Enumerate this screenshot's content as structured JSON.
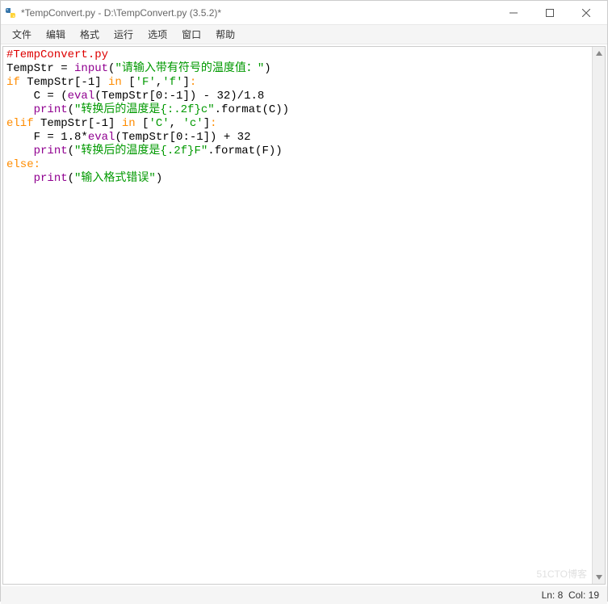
{
  "window": {
    "title": "*TempConvert.py - D:\\TempConvert.py (3.5.2)*"
  },
  "menu": {
    "items": [
      "文件",
      "编辑",
      "格式",
      "运行",
      "选项",
      "窗口",
      "帮助"
    ]
  },
  "code": {
    "lines": [
      {
        "tokens": [
          {
            "t": "#TempConvert.py",
            "c": "c-comment"
          }
        ]
      },
      {
        "tokens": [
          {
            "t": "TempStr = ",
            "c": ""
          },
          {
            "t": "input",
            "c": "c-builtin"
          },
          {
            "t": "(",
            "c": ""
          },
          {
            "t": "\"请输入带有符号的温度值：\"",
            "c": "c-str"
          },
          {
            "t": ")",
            "c": ""
          }
        ]
      },
      {
        "tokens": [
          {
            "t": "if",
            "c": "c-kw"
          },
          {
            "t": " TempStr[-1] ",
            "c": ""
          },
          {
            "t": "in",
            "c": "c-kw"
          },
          {
            "t": " [",
            "c": ""
          },
          {
            "t": "'F'",
            "c": "c-str"
          },
          {
            "t": ",",
            "c": ""
          },
          {
            "t": "'f'",
            "c": "c-str"
          },
          {
            "t": "]",
            "c": ""
          },
          {
            "t": ":",
            "c": "c-punct"
          }
        ]
      },
      {
        "tokens": [
          {
            "t": "    C = (",
            "c": ""
          },
          {
            "t": "eval",
            "c": "c-builtin"
          },
          {
            "t": "(TempStr[0:-1]) - 32)/1.8",
            "c": ""
          }
        ]
      },
      {
        "tokens": [
          {
            "t": "    ",
            "c": ""
          },
          {
            "t": "print",
            "c": "c-builtin"
          },
          {
            "t": "(",
            "c": ""
          },
          {
            "t": "\"转换后的温度是{:.2f}c\"",
            "c": "c-str"
          },
          {
            "t": ".format(C))",
            "c": ""
          }
        ]
      },
      {
        "tokens": [
          {
            "t": "elif",
            "c": "c-kw"
          },
          {
            "t": " TempStr[-1] ",
            "c": ""
          },
          {
            "t": "in",
            "c": "c-kw"
          },
          {
            "t": " [",
            "c": ""
          },
          {
            "t": "'C'",
            "c": "c-str"
          },
          {
            "t": ", ",
            "c": ""
          },
          {
            "t": "'c'",
            "c": "c-str"
          },
          {
            "t": "]",
            "c": ""
          },
          {
            "t": ":",
            "c": "c-punct"
          }
        ]
      },
      {
        "tokens": [
          {
            "t": "    F = 1.8*",
            "c": ""
          },
          {
            "t": "eval",
            "c": "c-builtin"
          },
          {
            "t": "(TempStr[0:-1]) + 32",
            "c": ""
          }
        ]
      },
      {
        "tokens": [
          {
            "t": "    ",
            "c": ""
          },
          {
            "t": "print",
            "c": "c-builtin"
          },
          {
            "t": "(",
            "c": ""
          },
          {
            "t": "\"转换后的温度是{.2f}F\"",
            "c": "c-str"
          },
          {
            "t": ".format(F))",
            "c": ""
          }
        ]
      },
      {
        "tokens": [
          {
            "t": "else",
            "c": "c-kw"
          },
          {
            "t": ":",
            "c": "c-punct"
          }
        ]
      },
      {
        "tokens": [
          {
            "t": "    ",
            "c": ""
          },
          {
            "t": "print",
            "c": "c-builtin"
          },
          {
            "t": "(",
            "c": ""
          },
          {
            "t": "\"输入格式错误\"",
            "c": "c-str"
          },
          {
            "t": ")",
            "c": ""
          }
        ]
      }
    ]
  },
  "status": {
    "ln_label": "Ln:",
    "ln": "8",
    "col_label": "Col:",
    "col": "19"
  },
  "watermark": "51CTO博客"
}
